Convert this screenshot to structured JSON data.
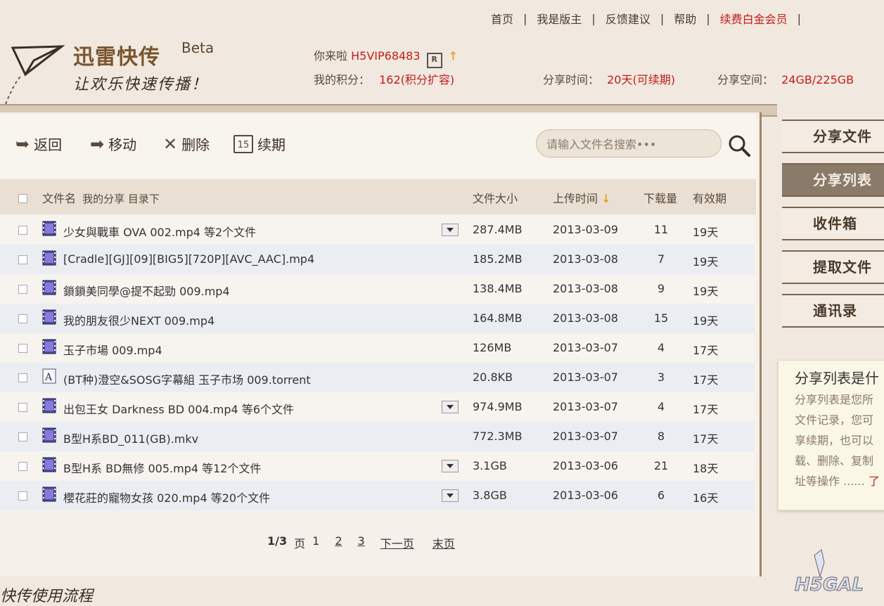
{
  "topnav": {
    "items": [
      "首页",
      "我是版主",
      "反馈建议",
      "帮助"
    ],
    "vip_link": "续费白金会员",
    "separator": "|"
  },
  "logo": {
    "title": "迅雷快传",
    "beta": "Beta",
    "slogan": "让欢乐快速传播！"
  },
  "user": {
    "greeting": "你来啦",
    "username": "H5VIP68483",
    "points_label": "我的积分：",
    "points_value": "162(积分扩容)",
    "share_time_label": "分享时间：",
    "share_time_value": "20天(可续期)",
    "share_space_label": "分享空间：",
    "share_space_value": "24GB/225GB"
  },
  "toolbar": {
    "back": "返回",
    "move": "移动",
    "delete": "删除",
    "renew": "续期",
    "renew_icon_text": "15",
    "search_placeholder": "请输入文件名搜索•••"
  },
  "table": {
    "headers": {
      "filename": "文件名",
      "path": "我的分享 目录下",
      "size": "文件大小",
      "upload": "上传时间",
      "downloads": "下载量",
      "validity": "有效期"
    },
    "rows": [
      {
        "name": "少女與戰車 OVA 002.mp4 等2个文件",
        "size": "287.4MB",
        "date": "2013-03-09",
        "dl": "11",
        "valid": "19天",
        "icon": "video-file-icon",
        "dropdown": true
      },
      {
        "name": "[Cradle][GJ][09][BIG5][720P][AVC_AAC].mp4",
        "size": "185.2MB",
        "date": "2013-03-08",
        "dl": "7",
        "valid": "19天",
        "icon": "video-file-icon",
        "dropdown": false
      },
      {
        "name": "鎖鎖美同學@提不起勁 009.mp4",
        "size": "138.4MB",
        "date": "2013-03-08",
        "dl": "9",
        "valid": "19天",
        "icon": "video-file-icon",
        "dropdown": false
      },
      {
        "name": "我的朋友很少NEXT 009.mp4",
        "size": "164.8MB",
        "date": "2013-03-08",
        "dl": "15",
        "valid": "19天",
        "icon": "video-file-icon",
        "dropdown": false
      },
      {
        "name": "玉子市場 009.mp4",
        "size": "126MB",
        "date": "2013-03-07",
        "dl": "4",
        "valid": "17天",
        "icon": "video-file-icon",
        "dropdown": false
      },
      {
        "name": "(BT种)澄空&SOSG字幕組 玉子市场 009.torrent",
        "size": "20.8KB",
        "date": "2013-03-07",
        "dl": "3",
        "valid": "17天",
        "icon": "text-file-icon",
        "dropdown": false
      },
      {
        "name": "出包王女 Darkness BD 004.mp4 等6个文件",
        "size": "974.9MB",
        "date": "2013-03-07",
        "dl": "4",
        "valid": "17天",
        "icon": "video-file-icon",
        "dropdown": true
      },
      {
        "name": "B型H系BD_011(GB).mkv",
        "size": "772.3MB",
        "date": "2013-03-07",
        "dl": "8",
        "valid": "17天",
        "icon": "video-file-icon",
        "dropdown": false
      },
      {
        "name": "B型H系 BD無修 005.mp4 等12个文件",
        "size": "3.1GB",
        "date": "2013-03-06",
        "dl": "21",
        "valid": "18天",
        "icon": "video-file-icon",
        "dropdown": true
      },
      {
        "name": "櫻花莊的寵物女孩 020.mp4 等20个文件",
        "size": "3.8GB",
        "date": "2013-03-06",
        "dl": "6",
        "valid": "16天",
        "icon": "video-file-icon",
        "dropdown": true
      }
    ]
  },
  "pager": {
    "current": "1",
    "total": "/3",
    "page_word": "页",
    "pages": [
      "1",
      "2",
      "3"
    ],
    "next": "下一页",
    "last": "末页"
  },
  "sidenav": {
    "items": [
      "分享文件",
      "分享列表",
      "收件箱",
      "提取文件",
      "通讯录"
    ],
    "active_index": 1
  },
  "help": {
    "title": "分享列表是什",
    "lines": [
      "分享列表是您所",
      "文件记录，您可",
      "享续期，也可以",
      "载、删除、复制",
      "址等操作 ......"
    ],
    "more": "了"
  },
  "footer": {
    "text": "快传使用流程"
  },
  "watermark": "H5GAL",
  "colors": {
    "accent_red": "#c41c1c",
    "brown": "#7b5530",
    "arrow_orange": "#f39a1e"
  }
}
